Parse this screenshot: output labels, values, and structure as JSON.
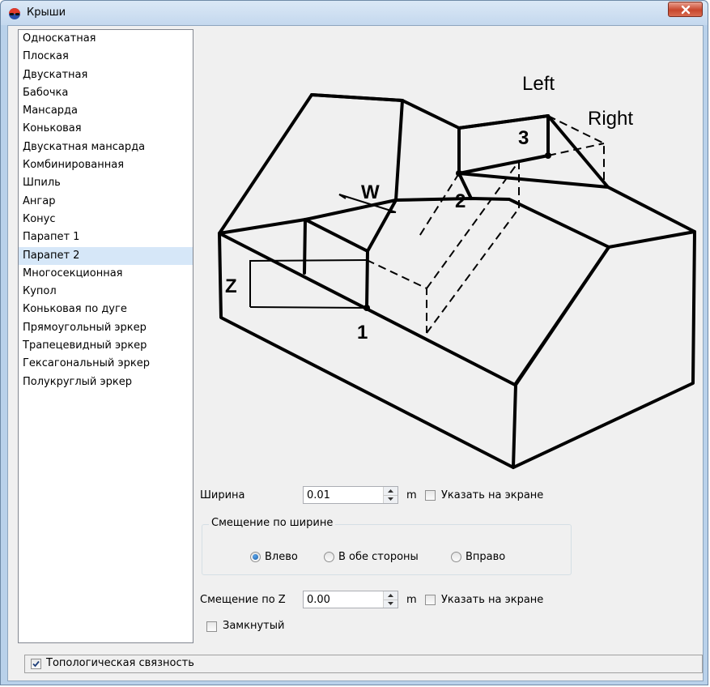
{
  "window": {
    "title": "Крыши",
    "app_icon": "colored-glasses-icon",
    "close_icon": "close-icon"
  },
  "roof_list": {
    "items": [
      "Односкатная",
      "Плоская",
      "Двускатная",
      "Бабочка",
      "Мансарда",
      "Коньковая",
      "Двускатная мансарда",
      "Комбинированная",
      "Шпиль",
      "Ангар",
      "Конус",
      "Парапет 1",
      "Парапет 2",
      "Многосекционная",
      "Купол",
      "Коньковая по дуге",
      "Прямоугольный эркер",
      "Трапецевидный эркер",
      "Гексагональный эркер",
      "Полукруглый эркер"
    ],
    "selected": "Парапет 2"
  },
  "diagram": {
    "labels": {
      "left": "Left",
      "right": "Right",
      "w": "W",
      "z": "Z",
      "p1": "1",
      "p2": "2",
      "p3": "3"
    }
  },
  "width_field": {
    "label": "Ширина",
    "value": "0.01",
    "unit": "m",
    "pick_on_screen": "Указать на экране",
    "pick_checked": false
  },
  "width_offset": {
    "group_title": "Смещение по ширине",
    "options": [
      "Влево",
      "В обе стороны",
      "Вправо"
    ],
    "selected": "Влево"
  },
  "z_field": {
    "label": "Смещение по Z",
    "value": "0.00",
    "unit": "m",
    "pick_on_screen": "Указать на экране",
    "pick_checked": false
  },
  "closed": {
    "label": "Замкнутый",
    "checked": false
  },
  "topology": {
    "label": "Топологическая связность",
    "checked": true
  },
  "colors": {
    "selection": "#d6e7f8",
    "radio_selected": "#1a5ea8",
    "close_button": "#c8472d"
  }
}
